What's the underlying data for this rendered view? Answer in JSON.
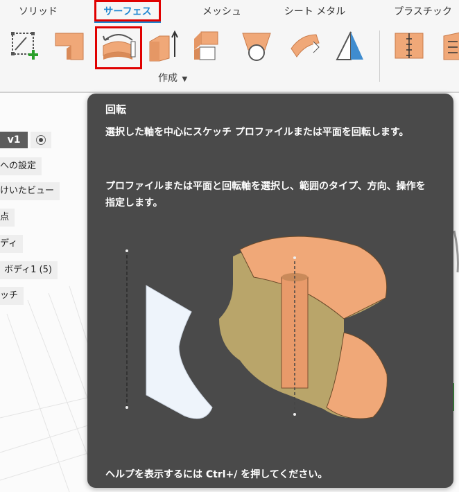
{
  "tabs": {
    "solid": "ソリッド",
    "surface": "サーフェス",
    "mesh": "メッシュ",
    "sheet_metal": "シート メタル",
    "plastic": "プラスチック"
  },
  "group": {
    "label": "作成",
    "dropdown_icon": "caret-down-icon"
  },
  "tools": [
    "create-sketch-icon",
    "extrude-icon",
    "revolve-icon",
    "sweep-icon",
    "loft-icon",
    "patch-icon",
    "ruled-icon",
    "offset-icon",
    "plane-icon",
    "rule-plastic-icon",
    "rule-plastic-2-icon"
  ],
  "browser": {
    "version": "v1",
    "items": [
      "への設定",
      "けいたビュー",
      "点",
      "ディ",
      "ボディ1 (5)",
      "ッチ"
    ]
  },
  "tooltip": {
    "title": "回転",
    "description": "選択した軸を中心にスケッチ プロファイルまたは平面を回転します。",
    "instructions": "プロファイルまたは平面と回転軸を選択し、範囲のタイプ、方向、操作を指定します。",
    "help": "ヘルプを表示するには Ctrl+/ を押してください。"
  },
  "colors": {
    "accent": "#1d86d1",
    "highlight": "#e00000",
    "tooltip_bg": "#4a4a4a",
    "solid_orange": "#f0a878"
  }
}
